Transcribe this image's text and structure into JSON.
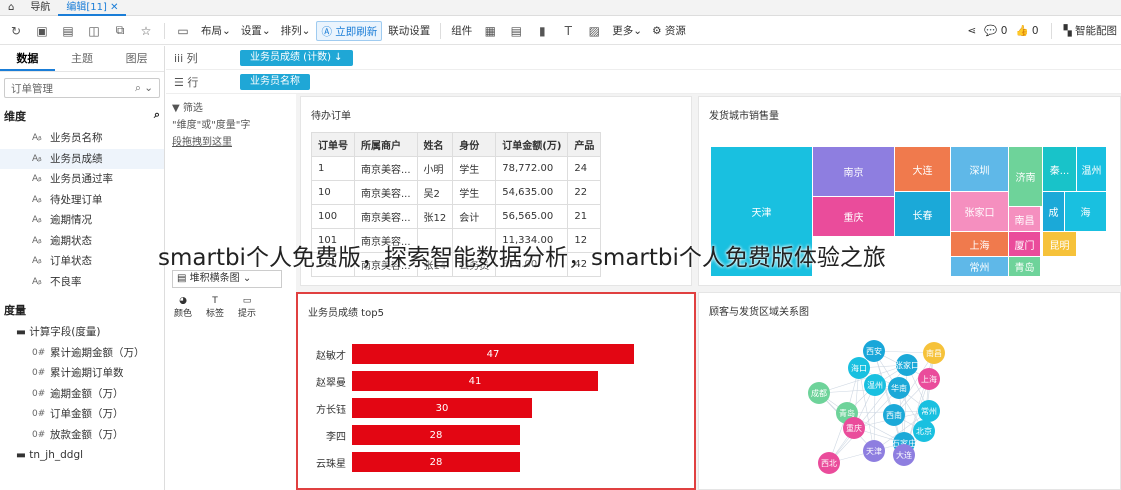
{
  "topbar": {
    "nav": "导航",
    "tab": "编辑[11]"
  },
  "toolbar": {
    "layout": "布局",
    "settings": "设置",
    "sort": "排列",
    "refresh": "立即刷新",
    "linkage": "联动设置",
    "component": "组件",
    "more": "更多",
    "resource": "资源",
    "comments": "0",
    "likes": "0",
    "smart": "智能配图"
  },
  "left": {
    "tabs": [
      "数据",
      "主题",
      "图层"
    ],
    "dataset": "订单管理",
    "search_placeholder": "",
    "dim_title": "维度",
    "dims": [
      "业务员名称",
      "业务员成绩",
      "业务员通过率",
      "待处理订单",
      "逾期情况",
      "逾期状态",
      "订单状态",
      "不良率"
    ],
    "measure_title": "度量",
    "folder1": "计算字段(度量)",
    "measures": [
      "累计逾期金额（万）",
      "累计逾期订单数",
      "逾期金额（万）",
      "订单金额（万）",
      "放款金额（万）"
    ],
    "folder2": "tn_jh_ddgl"
  },
  "rowcol": {
    "col_label": "列",
    "row_label": "行",
    "col_pill": "业务员成绩 (计数) ↓",
    "row_pill": "业务员名称"
  },
  "filter": {
    "title": "筛选",
    "hint": "\"维度\"或\"度量\"字",
    "hint2": "段拖拽到这里"
  },
  "chart_tools": {
    "chart_type": "堆积横条图",
    "color": "颜色",
    "label": "标签",
    "tooltip": "提示"
  },
  "table_card": {
    "title": "待办订单",
    "headers": [
      "订单号",
      "所属商户",
      "姓名",
      "身份",
      "订单金额(万)",
      "产品"
    ],
    "rows": [
      [
        "1",
        "南京美容...",
        "小明",
        "学生",
        "78,772.00",
        "24"
      ],
      [
        "10",
        "南京美容...",
        "吴2",
        "学生",
        "54,635.00",
        "22"
      ],
      [
        "100",
        "南京美容...",
        "张12",
        "会计",
        "56,565.00",
        "21"
      ],
      [
        "101",
        "南京美容...",
        "",
        "",
        "11,334.00",
        "12"
      ],
      [
        "102",
        "南京美容...",
        "张14",
        "公务员",
        "879.00",
        "42"
      ]
    ]
  },
  "treemap_card": {
    "title": "发货城市销售量",
    "cells": [
      {
        "name": "天津",
        "color": "#19c0e0"
      },
      {
        "name": "南京",
        "color": "#8e7ee0"
      },
      {
        "name": "大连",
        "color": "#f07a4d"
      },
      {
        "name": "深圳",
        "color": "#5fb8e8"
      },
      {
        "name": "济南",
        "color": "#6ed39a"
      },
      {
        "name": "秦...",
        "color": "#18c3c9"
      },
      {
        "name": "温州",
        "color": "#19c0e0"
      },
      {
        "name": "重庆",
        "color": "#ea4c9b"
      },
      {
        "name": "长春",
        "color": "#1ba9d8"
      },
      {
        "name": "张家口",
        "color": "#f58fbf"
      },
      {
        "name": "南昌",
        "color": "#f58fbf"
      },
      {
        "name": "成",
        "color": "#1ba9d8"
      },
      {
        "name": "海",
        "color": "#19c0e0"
      },
      {
        "name": "上海",
        "color": "#f07a4d"
      },
      {
        "name": "厦门",
        "color": "#ea4c9b"
      },
      {
        "name": "昆明",
        "color": "#f6c23a"
      },
      {
        "name": "常州",
        "color": "#5fb8e8"
      },
      {
        "name": "青岛",
        "color": "#6ed39a"
      }
    ]
  },
  "bar_card": {
    "title": "业务员成绩 top5"
  },
  "chart_data": {
    "type": "bar",
    "title": "业务员成绩 top5",
    "categories": [
      "赵敏才",
      "赵翠曼",
      "方长钰",
      "李四",
      "云珠星"
    ],
    "values": [
      47,
      41,
      30,
      28,
      28
    ],
    "xlim": [
      0,
      50
    ]
  },
  "graph_card": {
    "title": "顾客与发货区域关系图",
    "nodes": [
      {
        "name": "西安",
        "color": "#19a7d9"
      },
      {
        "name": "海口",
        "color": "#19c0e0"
      },
      {
        "name": "张家口",
        "color": "#1ba9d8"
      },
      {
        "name": "南昌",
        "color": "#f6c23a"
      },
      {
        "name": "温州",
        "color": "#19c0e0"
      },
      {
        "name": "华南",
        "color": "#1ba9d8"
      },
      {
        "name": "上海",
        "color": "#ea4c9b"
      },
      {
        "name": "成都",
        "color": "#6ed39a"
      },
      {
        "name": "青岛",
        "color": "#6ed39a"
      },
      {
        "name": "西南",
        "color": "#1ba9d8"
      },
      {
        "name": "常州",
        "color": "#19c0e0"
      },
      {
        "name": "重庆",
        "color": "#ea4c9b"
      },
      {
        "name": "北京",
        "color": "#19c0e0"
      },
      {
        "name": "石家庄",
        "color": "#1ba9d8"
      },
      {
        "name": "天津",
        "color": "#8e7ee0"
      },
      {
        "name": "大连",
        "color": "#8e7ee0"
      },
      {
        "name": "西北",
        "color": "#ea4c9b"
      }
    ]
  },
  "watermark": "smartbi个人免费版，探索智能数据分析，smartbi个人免费版体验之旅"
}
